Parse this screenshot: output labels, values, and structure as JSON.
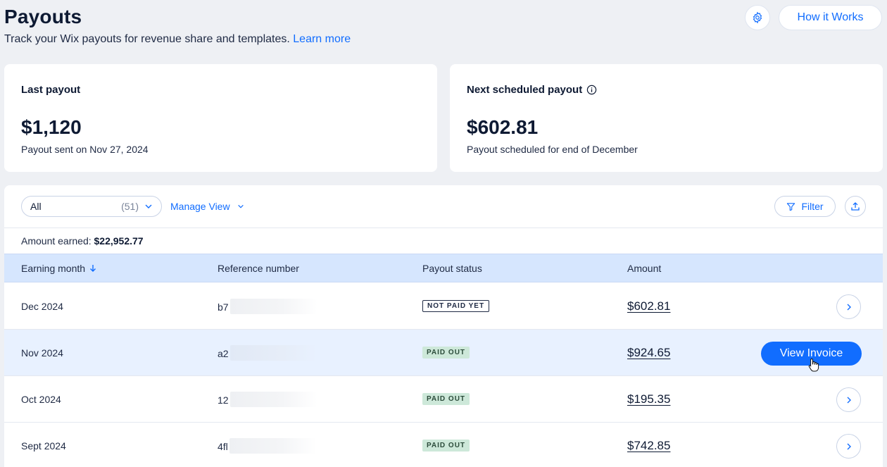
{
  "header": {
    "title": "Payouts",
    "subtitle": "Track your Wix payouts for revenue share and templates.",
    "learn_more": "Learn more",
    "how_it_works": "How it Works",
    "settings_icon": "gear-icon"
  },
  "cards": {
    "last": {
      "title": "Last payout",
      "value": "$1,120",
      "sub": "Payout sent on Nov 27, 2024"
    },
    "next": {
      "title": "Next scheduled payout",
      "value": "$602.81",
      "sub": "Payout scheduled for end of December",
      "info_icon": "info-icon"
    }
  },
  "toolbar": {
    "view_label": "All",
    "view_count": "(51)",
    "manage_view": "Manage View",
    "filter": "Filter"
  },
  "summary": {
    "label": "Amount earned:",
    "value": "$22,952.77"
  },
  "table": {
    "columns": [
      "Earning month",
      "Reference number",
      "Payout status",
      "Amount"
    ],
    "rows": [
      {
        "month": "Dec 2024",
        "ref": "b7",
        "status": "NOT PAID YET",
        "amount": "$602.81"
      },
      {
        "month": "Nov 2024",
        "ref": "a2",
        "status": "PAID OUT",
        "amount": "$924.65"
      },
      {
        "month": "Oct 2024",
        "ref": "12",
        "status": "PAID OUT",
        "amount": "$195.35"
      },
      {
        "month": "Sept 2024",
        "ref": "4fl",
        "status": "PAID OUT",
        "amount": "$742.85"
      }
    ],
    "view_invoice": "View Invoice"
  },
  "colors": {
    "accent": "#116dff",
    "header_row": "#d6e6fe",
    "paid_badge": "#cde8d9",
    "hover_row": "#e8f1ff"
  }
}
